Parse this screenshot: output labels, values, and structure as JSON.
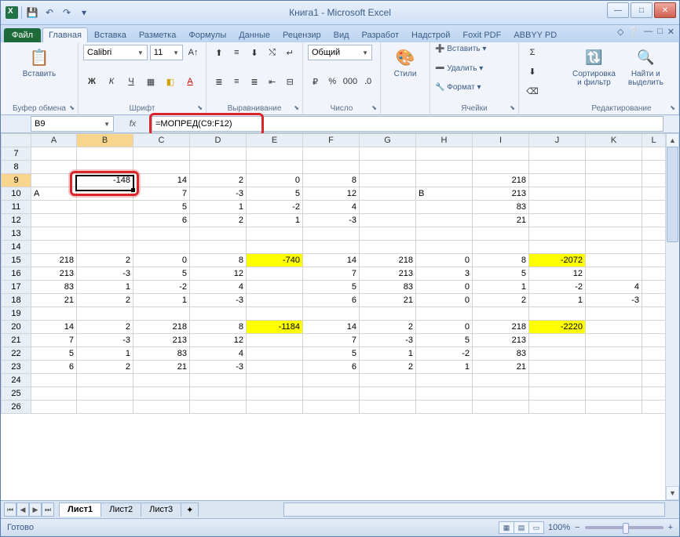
{
  "title": "Книга1 - Microsoft Excel",
  "qat": {
    "save": "💾",
    "undo": "↶",
    "redo": "↷",
    "dd": "▾"
  },
  "winbtns": {
    "min": "—",
    "max": "□",
    "close": "✕"
  },
  "tabs": {
    "file": "Файл",
    "items": [
      "Главная",
      "Вставка",
      "Разметка",
      "Формулы",
      "Данные",
      "Рецензир",
      "Вид",
      "Разработ",
      "Надстрой",
      "Foxit PDF",
      "ABBYY PD"
    ],
    "active_index": 0
  },
  "ribbon": {
    "clipboard": {
      "paste": "Вставить",
      "paste_icon": "📋",
      "label": "Буфер обмена"
    },
    "font": {
      "name": "Calibri",
      "size": "11",
      "label": "Шрифт"
    },
    "align": {
      "label": "Выравнивание"
    },
    "number": {
      "fmt": "Общий",
      "label": "Число"
    },
    "styles": {
      "btn": "Стили",
      "label": ""
    },
    "cells": {
      "insert": "Вставить ▾",
      "delete": "Удалить ▾",
      "format": "Формат ▾",
      "label": "Ячейки"
    },
    "editing": {
      "sort": "Сортировка\nи фильтр",
      "find": "Найти и\nвыделить",
      "label": "Редактирование"
    }
  },
  "namebox": "B9",
  "fx": "fx",
  "formula": "=МОПРЕД(C9:F12)",
  "cols": [
    "",
    "A",
    "B",
    "C",
    "D",
    "E",
    "F",
    "G",
    "H",
    "I",
    "J",
    "K",
    "L"
  ],
  "widths": [
    38,
    58,
    72,
    72,
    72,
    72,
    72,
    72,
    72,
    72,
    72,
    72,
    30
  ],
  "rows": [
    {
      "n": 7,
      "c": [
        "",
        "",
        "",
        "",
        "",
        "",
        "",
        "",
        "",
        "",
        "",
        ""
      ]
    },
    {
      "n": 8,
      "c": [
        "",
        "",
        "",
        "",
        "",
        "",
        "",
        "",
        "",
        "",
        "",
        ""
      ]
    },
    {
      "n": 9,
      "c": [
        "",
        "-148",
        "14",
        "2",
        "0",
        "8",
        "",
        "",
        "218",
        "",
        "",
        ""
      ],
      "sel": true,
      "hl": [
        1
      ]
    },
    {
      "n": 10,
      "c": [
        "A",
        "",
        "7",
        "-3",
        "5",
        "12",
        "",
        "B",
        "213",
        "",
        "",
        ""
      ],
      "lt": [
        0,
        7
      ]
    },
    {
      "n": 11,
      "c": [
        "",
        "",
        "5",
        "1",
        "-2",
        "4",
        "",
        "",
        "83",
        "",
        "",
        ""
      ]
    },
    {
      "n": 12,
      "c": [
        "",
        "",
        "6",
        "2",
        "1",
        "-3",
        "",
        "",
        "21",
        "",
        "",
        ""
      ]
    },
    {
      "n": 13,
      "c": [
        "",
        "",
        "",
        "",
        "",
        "",
        "",
        "",
        "",
        "",
        "",
        ""
      ]
    },
    {
      "n": 14,
      "c": [
        "",
        "",
        "",
        "",
        "",
        "",
        "",
        "",
        "",
        "",
        "",
        ""
      ]
    },
    {
      "n": 15,
      "c": [
        "218",
        "2",
        "0",
        "8",
        "-740",
        "14",
        "218",
        "0",
        "8",
        "-2072",
        "",
        ""
      ],
      "ylw": [
        4,
        9
      ]
    },
    {
      "n": 16,
      "c": [
        "213",
        "-3",
        "5",
        "12",
        "",
        "7",
        "213",
        "3",
        "5",
        "12",
        "",
        ""
      ]
    },
    {
      "n": 17,
      "c": [
        "83",
        "1",
        "-2",
        "4",
        "",
        "5",
        "83",
        "0",
        "1",
        "-2",
        "4",
        ""
      ]
    },
    {
      "n": 18,
      "c": [
        "21",
        "2",
        "1",
        "-3",
        "",
        "6",
        "21",
        "0",
        "2",
        "1",
        "-3",
        ""
      ]
    },
    {
      "n": 19,
      "c": [
        "",
        "",
        "",
        "",
        "",
        "",
        "",
        "",
        "",
        "",
        "",
        ""
      ]
    },
    {
      "n": 20,
      "c": [
        "14",
        "2",
        "218",
        "8",
        "-1184",
        "14",
        "2",
        "0",
        "218",
        "-2220",
        "",
        ""
      ],
      "ylw": [
        4,
        9
      ]
    },
    {
      "n": 21,
      "c": [
        "7",
        "-3",
        "213",
        "12",
        "",
        "7",
        "-3",
        "5",
        "213",
        "",
        "",
        ""
      ]
    },
    {
      "n": 22,
      "c": [
        "5",
        "1",
        "83",
        "4",
        "",
        "5",
        "1",
        "-2",
        "83",
        "",
        "",
        ""
      ]
    },
    {
      "n": 23,
      "c": [
        "6",
        "2",
        "21",
        "-3",
        "",
        "6",
        "2",
        "1",
        "21",
        "",
        "",
        ""
      ]
    },
    {
      "n": 24,
      "c": [
        "",
        "",
        "",
        "",
        "",
        "",
        "",
        "",
        "",
        "",
        "",
        ""
      ]
    },
    {
      "n": 25,
      "c": [
        "",
        "",
        "",
        "",
        "",
        "",
        "",
        "",
        "",
        "",
        "",
        ""
      ]
    },
    {
      "n": 26,
      "c": [
        "",
        "",
        "",
        "",
        "",
        "",
        "",
        "",
        "",
        "",
        "",
        ""
      ]
    }
  ],
  "sheets": {
    "items": [
      "Лист1",
      "Лист2",
      "Лист3"
    ],
    "active": 0,
    "new": "⋯"
  },
  "status": {
    "ready": "Готово",
    "zoom": "100%",
    "minus": "−",
    "plus": "+"
  }
}
